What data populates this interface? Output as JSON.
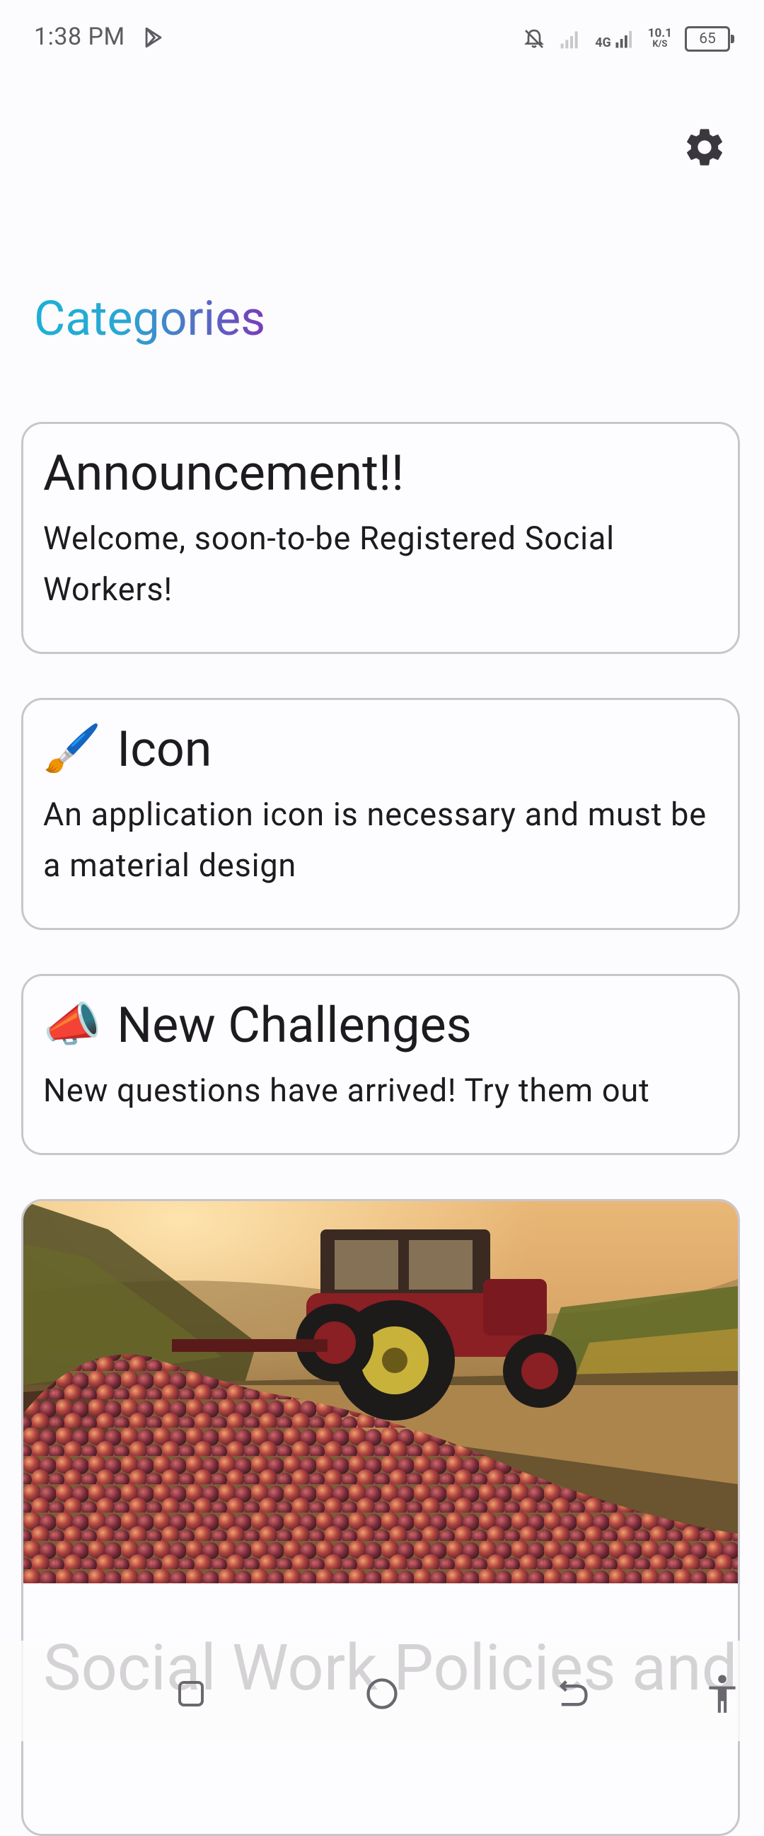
{
  "status_bar": {
    "time": "1:38 PM",
    "network_type": "4G",
    "net_speed_value": "10.1",
    "net_speed_unit": "K/S",
    "battery_level": "65"
  },
  "header": {
    "title": "Categories"
  },
  "cards": [
    {
      "emoji": "",
      "title": "Announcement!!",
      "body": "Welcome, soon-to-be Registered Social Workers!"
    },
    {
      "emoji": "🖌️",
      "title": "Icon",
      "body": "An application icon is necessary and must be a material design"
    },
    {
      "emoji": "📣",
      "title": "New Challenges",
      "body": "New questions have arrived! Try them out"
    },
    {
      "title": "Social Work Policies and Programs",
      "image": "vineyard-grapes-tractor"
    }
  ],
  "icons": {
    "settings": "gear-icon",
    "nav_recent": "square-icon",
    "nav_home": "circle-icon",
    "nav_back": "back-arrow-icon",
    "accessibility": "accessibility-icon"
  }
}
